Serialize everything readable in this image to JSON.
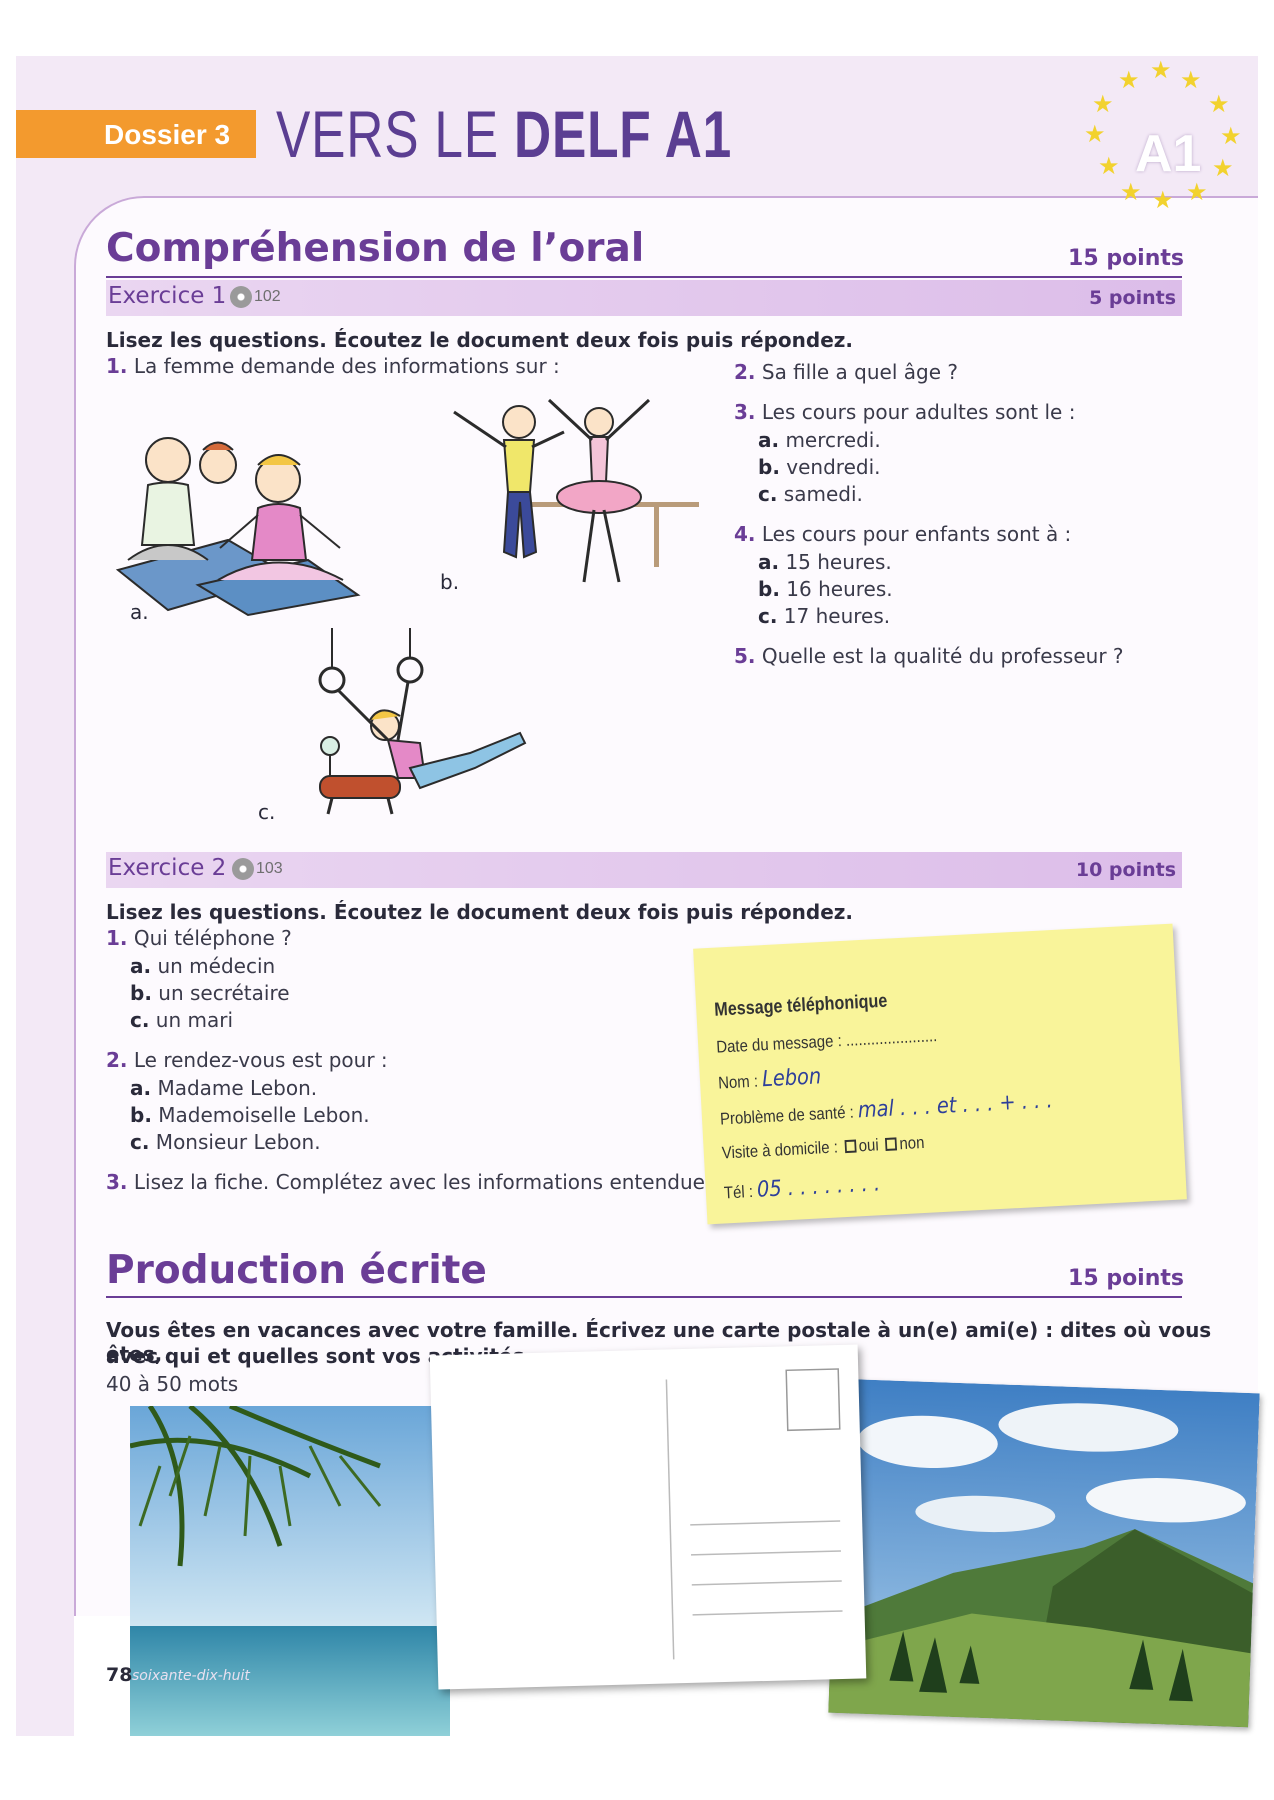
{
  "header": {
    "dossier_label": "Dossier 3",
    "title_prefix": "VERS LE ",
    "title_bold": "DELF A1",
    "badge": "A1"
  },
  "section1": {
    "title": "Compréhension de l’oral",
    "points": "15 points",
    "exercise1": {
      "label": "Exercice 1",
      "track": "102",
      "points": "5 points",
      "instruction": "Lisez les questions. Écoutez le document deux fois puis répondez.",
      "q1": {
        "num": "1.",
        "text": " La femme demande des informations sur :"
      },
      "captions": {
        "a": "a.",
        "b": "b.",
        "c": "c."
      },
      "q2": {
        "num": "2.",
        "text": " Sa fille a quel âge ?"
      },
      "q3": {
        "num": "3.",
        "text": " Les cours pour adultes sont le :",
        "options": [
          {
            "letter": "a.",
            "text": " mercredi."
          },
          {
            "letter": "b.",
            "text": " vendredi."
          },
          {
            "letter": "c.",
            "text": " samedi."
          }
        ]
      },
      "q4": {
        "num": "4.",
        "text": " Les cours pour enfants sont à :",
        "options": [
          {
            "letter": "a.",
            "text": " 15 heures."
          },
          {
            "letter": "b.",
            "text": " 16 heures."
          },
          {
            "letter": "c.",
            "text": " 17 heures."
          }
        ]
      },
      "q5": {
        "num": "5.",
        "text": " Quelle est la qualité du professeur ?"
      }
    },
    "exercise2": {
      "label": "Exercice 2",
      "track": "103",
      "points": "10 points",
      "instruction": "Lisez les questions. Écoutez le document deux fois puis répondez.",
      "q1": {
        "num": "1.",
        "text": " Qui téléphone ?",
        "options": [
          {
            "letter": "a.",
            "text": " un médecin"
          },
          {
            "letter": "b.",
            "text": " un secrétaire"
          },
          {
            "letter": "c.",
            "text": " un mari"
          }
        ]
      },
      "q2": {
        "num": "2.",
        "text": " Le rendez-vous est pour :",
        "options": [
          {
            "letter": "a.",
            "text": " Madame Lebon."
          },
          {
            "letter": "b.",
            "text": " Mademoiselle Lebon."
          },
          {
            "letter": "c.",
            "text": " Monsieur Lebon."
          }
        ]
      },
      "q3": {
        "num": "3.",
        "text": " Lisez la fiche. Complétez avec les informations entendues."
      },
      "message": {
        "title": "Message téléphonique",
        "date_label": "Date du message : ......................",
        "nom_label": "Nom : ",
        "nom_value": "Lebon",
        "probleme_label": "Problème de santé : ",
        "probleme_value": "mal",
        "probleme_rest": " . . .   et   . . .   +   . . .",
        "visite_label": "Visite à domicile : ",
        "oui": "oui",
        "non": "non",
        "tel_label": "Tél : ",
        "tel_value": "05",
        "tel_rest": "  . .   . .   . .   . ."
      }
    }
  },
  "section2": {
    "title": "Production écrite",
    "points": "15 points",
    "instruction_line1": "Vous êtes en vacances avec votre famille. Écrivez une carte postale à un(e) ami(e) : dites où vous êtes,",
    "instruction_line2": "avec qui et quelles sont vos activités.",
    "word_count": "40 à 50 mots"
  },
  "footer": {
    "page_number": "78",
    "page_word": "soixante-dix-huit"
  }
}
